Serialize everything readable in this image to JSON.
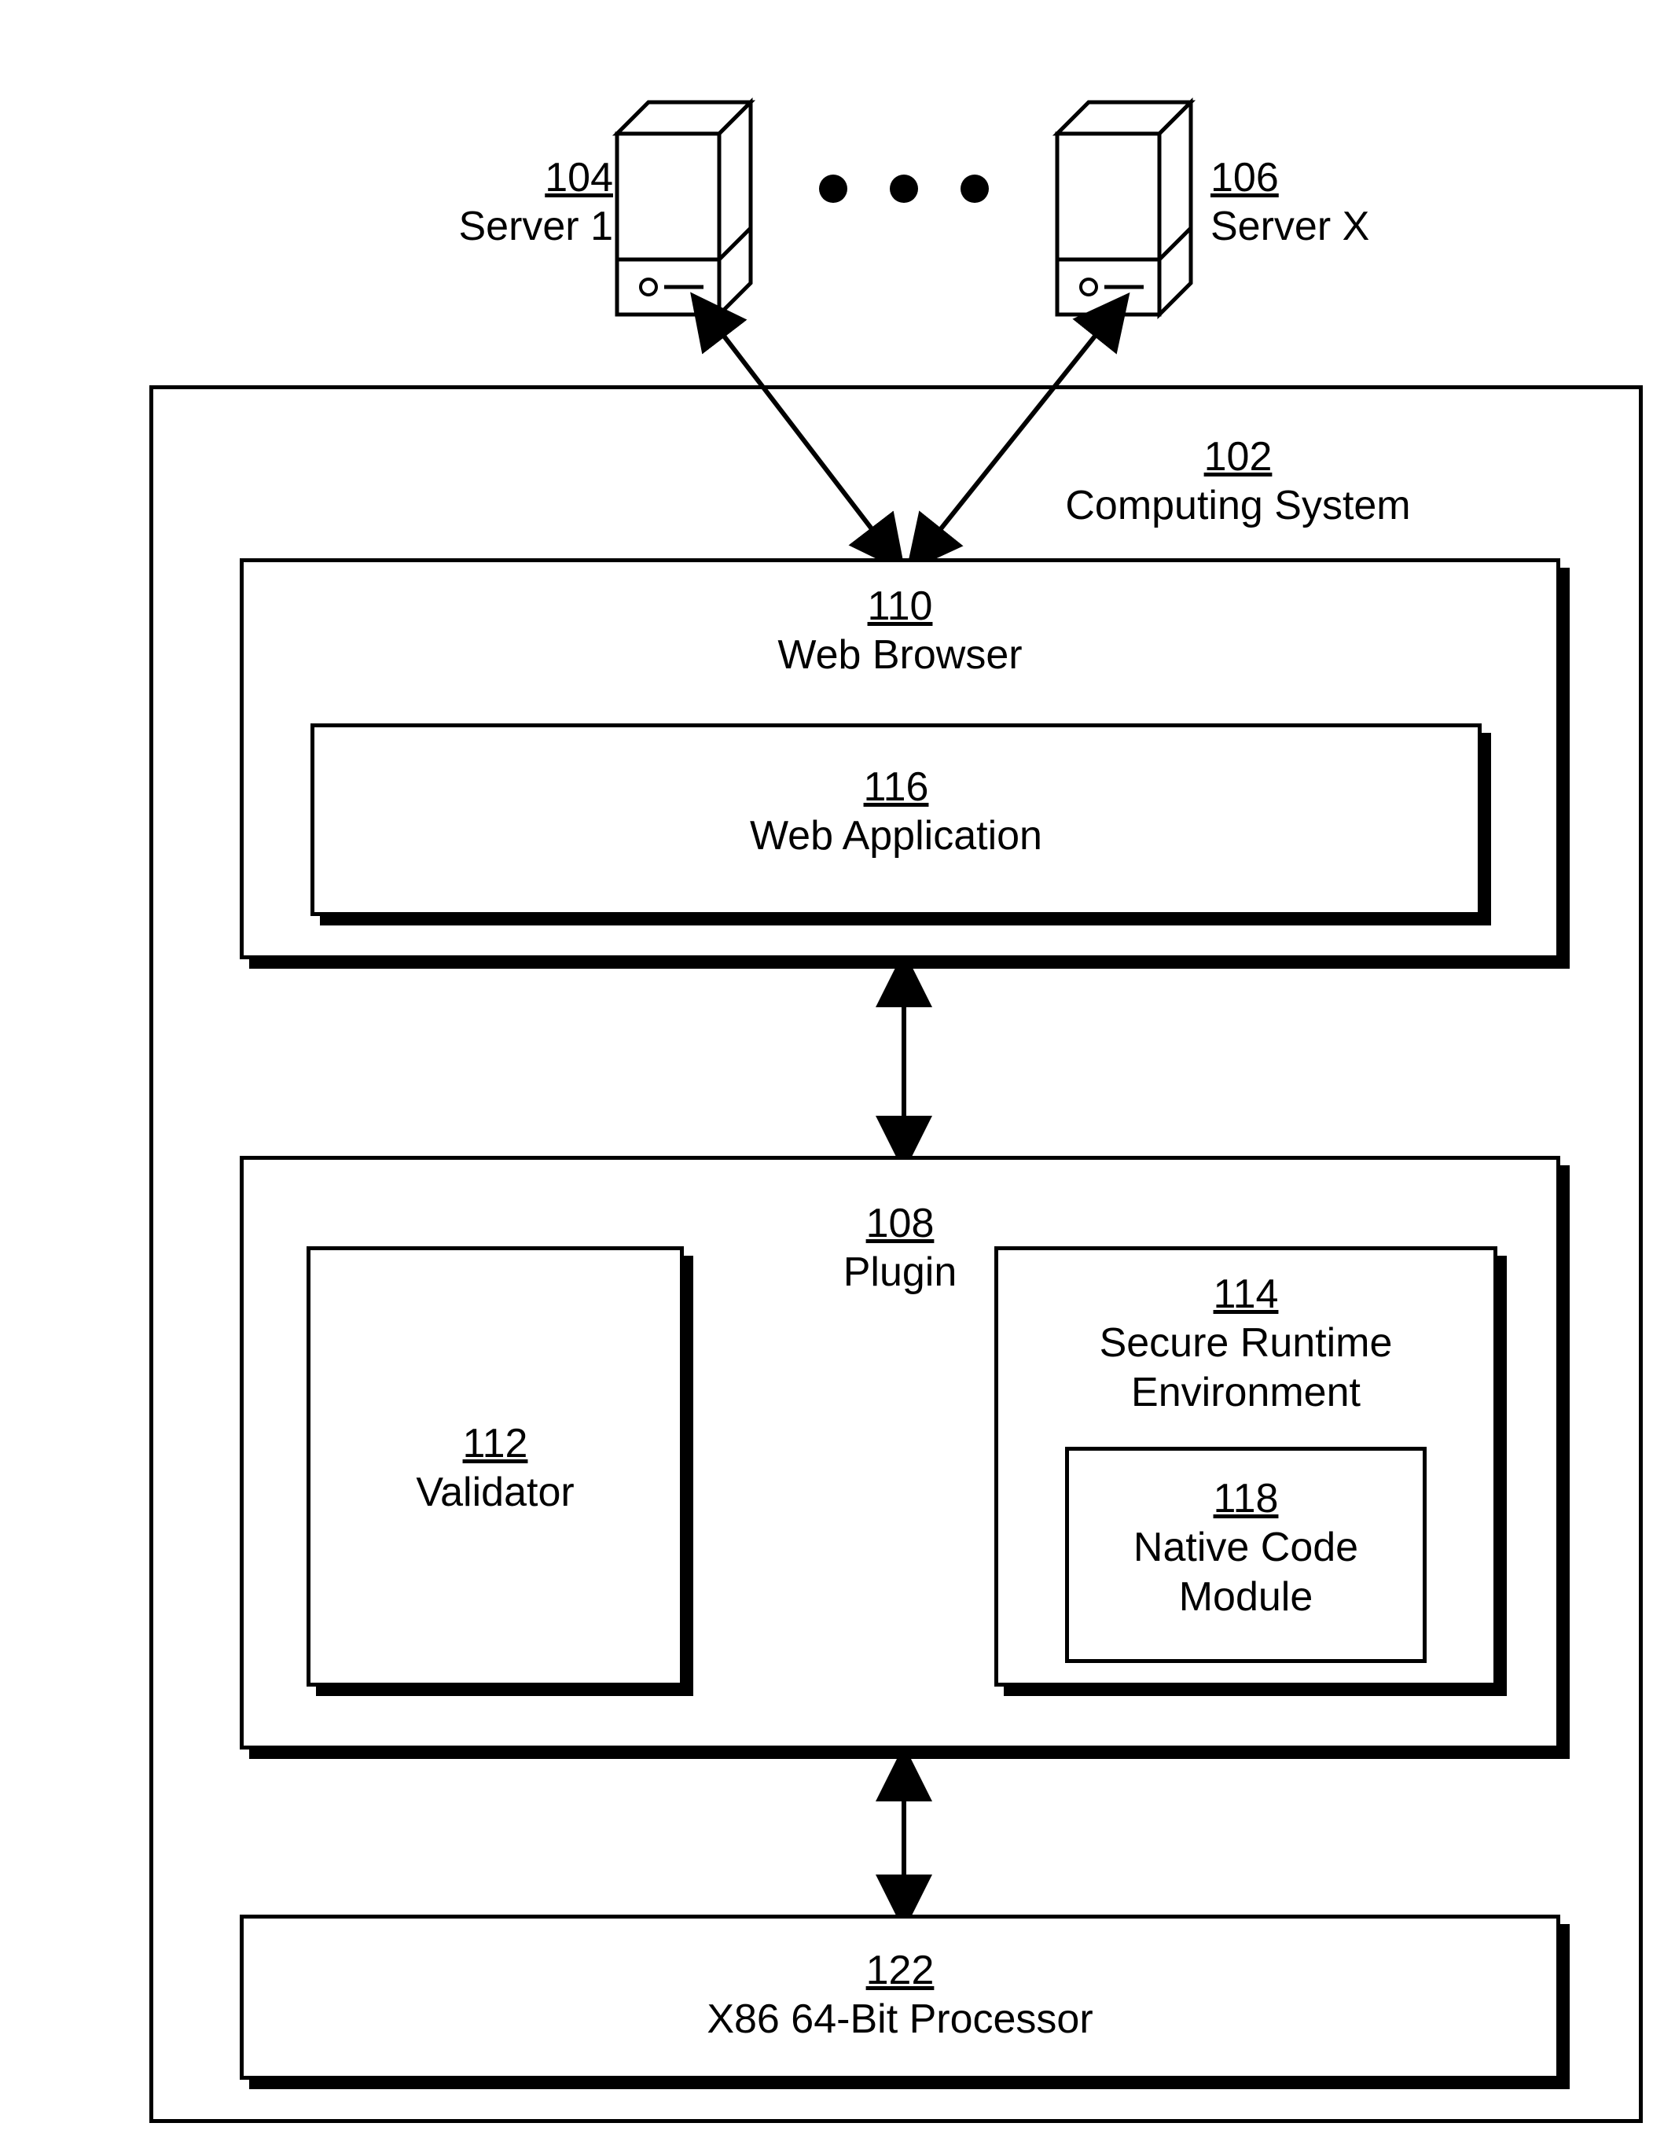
{
  "servers": {
    "left": {
      "num": "104",
      "name": "Server 1"
    },
    "right": {
      "num": "106",
      "name": "Server X"
    }
  },
  "system": {
    "num": "102",
    "name": "Computing System"
  },
  "browser": {
    "num": "110",
    "name": "Web Browser"
  },
  "webapp": {
    "num": "116",
    "name": "Web Application"
  },
  "plugin": {
    "num": "108",
    "name": "Plugin"
  },
  "validator": {
    "num": "112",
    "name": "Validator"
  },
  "sre": {
    "num": "114",
    "name": "Secure Runtime Environment"
  },
  "nativeModule": {
    "num": "118",
    "name": "Native Code Module"
  },
  "processor": {
    "num": "122",
    "name": "X86 64-Bit Processor"
  }
}
